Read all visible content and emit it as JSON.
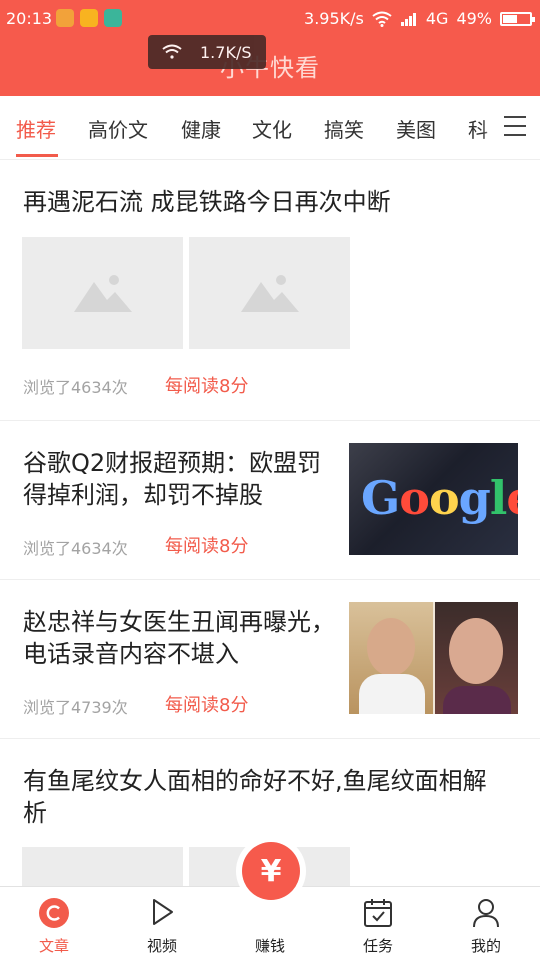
{
  "status_bar": {
    "time": "20:13",
    "network_speed": "3.95K/s",
    "network_type": "4G",
    "battery": "49%",
    "battery_level": 0.49
  },
  "toast": {
    "speed": "1.7K/S"
  },
  "app": {
    "title": "小牛快看",
    "accent_color": "#f65a4c"
  },
  "tabs": [
    {
      "label": "推荐",
      "active": true
    },
    {
      "label": "高价文",
      "active": false
    },
    {
      "label": "健康",
      "active": false
    },
    {
      "label": "文化",
      "active": false
    },
    {
      "label": "搞笑",
      "active": false
    },
    {
      "label": "美图",
      "active": false
    },
    {
      "label": "科",
      "active": false
    }
  ],
  "articles": [
    {
      "title": "再遇泥石流 成昆铁路今日再次中断",
      "views": "浏览了4634次",
      "reward": "每阅读8分",
      "image": "placeholder-images"
    },
    {
      "title": "谷歌Q2财报超预期：欧盟罚得掉利润，却罚不掉股",
      "views": "浏览了4634次",
      "reward": "每阅读8分",
      "image": "google-logo-photo"
    },
    {
      "title": "赵忠祥与女医生丑闻再曝光，电话录音内容不堪入",
      "views": "浏览了4739次",
      "reward": "每阅读8分",
      "image": "two-portraits-photo"
    },
    {
      "title": "有鱼尾纹女人面相的命好不好,鱼尾纹面相解析",
      "image": "placeholder-images"
    }
  ],
  "thumbnail_text": {
    "google_logo": "Google"
  },
  "bottom_nav": [
    {
      "label": "文章",
      "icon": "article-icon",
      "active": true
    },
    {
      "label": "视频",
      "icon": "play-icon",
      "active": false
    },
    {
      "label": "赚钱",
      "icon": "yuan-icon",
      "active": false
    },
    {
      "label": "任务",
      "icon": "calendar-check-icon",
      "active": false
    },
    {
      "label": "我的",
      "icon": "user-icon",
      "active": false
    }
  ],
  "earn_symbol": "¥"
}
